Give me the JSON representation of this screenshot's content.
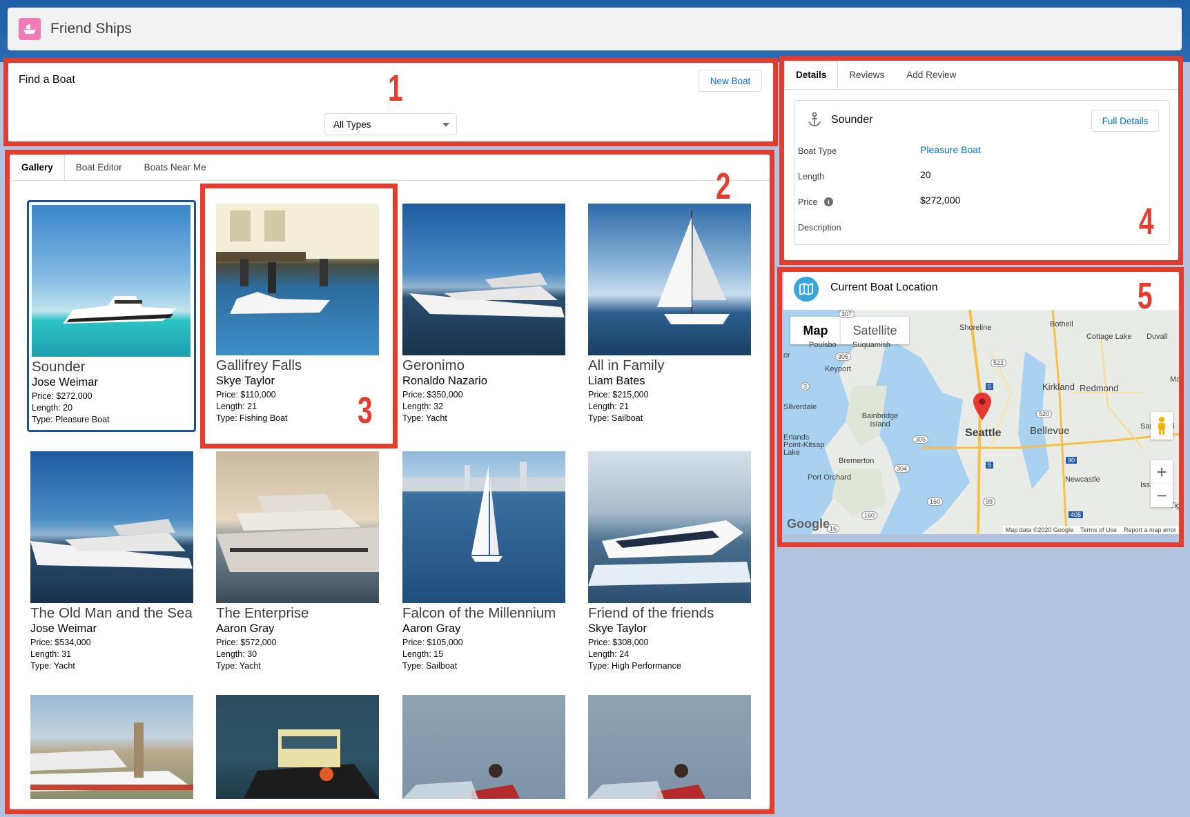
{
  "app": {
    "title": "Friend Ships"
  },
  "annotations": [
    "1",
    "2",
    "3",
    "4",
    "5"
  ],
  "search": {
    "title": "Find a Boat",
    "new_boat_label": "New Boat",
    "type_select": "All Types"
  },
  "gallery_tabs": [
    "Gallery",
    "Boat Editor",
    "Boats Near Me"
  ],
  "boats": [
    {
      "name": "Sounder",
      "owner": "Jose Weimar",
      "price": "Price: $272,000",
      "length": "Length: 20",
      "type": "Type: Pleasure Boat"
    },
    {
      "name": "Gallifrey Falls",
      "owner": "Skye Taylor",
      "price": "Price: $110,000",
      "length": "Length: 21",
      "type": "Type: Fishing Boat"
    },
    {
      "name": "Geronimo",
      "owner": "Ronaldo Nazario",
      "price": "Price: $350,000",
      "length": "Length: 32",
      "type": "Type: Yacht"
    },
    {
      "name": "All in Family",
      "owner": "Liam Bates",
      "price": "Price: $215,000",
      "length": "Length: 21",
      "type": "Type: Sailboat"
    },
    {
      "name": "The Old Man and the Sea",
      "owner": "Jose Weimar",
      "price": "Price: $534,000",
      "length": "Length: 31",
      "type": "Type: Yacht"
    },
    {
      "name": "The Enterprise",
      "owner": "Aaron Gray",
      "price": "Price: $572,000",
      "length": "Length: 30",
      "type": "Type: Yacht"
    },
    {
      "name": "Falcon of the Millennium",
      "owner": "Aaron Gray",
      "price": "Price: $105,000",
      "length": "Length: 15",
      "type": "Type: Sailboat"
    },
    {
      "name": "Friend of the friends",
      "owner": "Skye Taylor",
      "price": "Price: $308,000",
      "length": "Length: 24",
      "type": "Type: High Performance"
    }
  ],
  "details_tabs": [
    "Details",
    "Reviews",
    "Add Review"
  ],
  "details": {
    "boat_name": "Sounder",
    "full_details_label": "Full Details",
    "labels": {
      "type": "Boat Type",
      "length": "Length",
      "price": "Price",
      "description": "Description"
    },
    "values": {
      "type": "Pleasure Boat",
      "length": "20",
      "price": "$272,000"
    }
  },
  "location": {
    "title": "Current Boat Location",
    "map_toggle": [
      "Map",
      "Satellite"
    ],
    "footer": [
      "Map data ©2020 Google",
      "Terms of Use",
      "Report a map error"
    ],
    "google": "Google",
    "places": [
      "Shoreline",
      "Bothell",
      "Cottage Lake",
      "Duvall",
      "Suquamish",
      "Keyport",
      "Kirkland",
      "Redmond",
      "Silverdale",
      "Bainbridge Island",
      "Seattle",
      "Bellevue",
      "Sammami",
      "Erlands Point-Kitsap Lake",
      "Bremerton",
      "Port Orchard",
      "Newcastle",
      "Issaqua",
      "Marc",
      "Poulsbo",
      "Tige",
      "or"
    ],
    "shields": [
      "307",
      "305",
      "522",
      "5",
      "3",
      "520",
      "305",
      "5",
      "90",
      "304",
      "160",
      "99",
      "160",
      "405",
      "16"
    ]
  },
  "colors": {
    "accent": "#0070d2",
    "annotation": "#e33d2f",
    "selected": "#1b5297"
  }
}
